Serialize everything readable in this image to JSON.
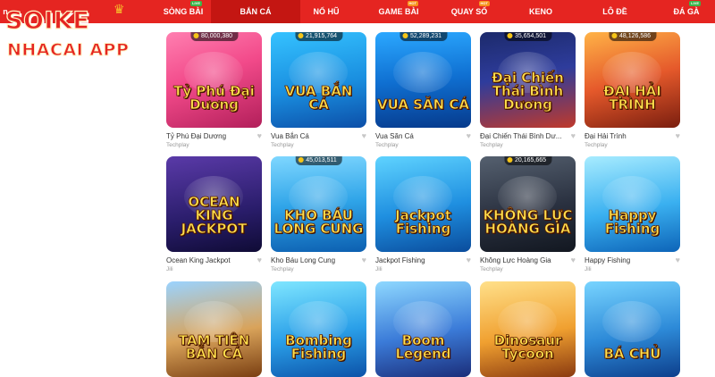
{
  "brand": {
    "line1": "SOIKE",
    "line2": "NHACAI APP"
  },
  "colors": {
    "nav": "#e52521",
    "nav_active": "#c41612",
    "live_tag": "#3ab54a",
    "hot_tag": "#f7931e"
  },
  "nav": {
    "partial_left": "n",
    "items": [
      {
        "label": "SÒNG BÀI",
        "tag": "LIVE"
      },
      {
        "label": "BẮN CÁ"
      },
      {
        "label": "NỔ HŨ"
      },
      {
        "label": "GAME BÀI",
        "tag": "HOT"
      },
      {
        "label": "QUAY SỐ",
        "tag": "HOT"
      },
      {
        "label": "KENO"
      },
      {
        "label": "LÔ ĐỀ"
      },
      {
        "label": "ĐÁ GÀ",
        "tag": "LIVE"
      }
    ]
  },
  "games": [
    {
      "title": "Tỷ Phú Đại Dương",
      "provider": "Techplay",
      "jackpot": "80,000,380",
      "art_text": "Tỷ Phú Đại Dương"
    },
    {
      "title": "Vua Bắn Cá",
      "provider": "Techplay",
      "jackpot": "21,915,764",
      "art_text": "VUA BẮN CÁ"
    },
    {
      "title": "Vua Săn Cá",
      "provider": "Techplay",
      "jackpot": "52,289,231",
      "art_text": "VUA SĂN CÁ"
    },
    {
      "title": "Đại Chiến Thái Bình Dư...",
      "provider": "Techplay",
      "jackpot": "35,654,501",
      "art_text": "Đại Chiến Thái Bình Dương"
    },
    {
      "title": "Đại Hải Trình",
      "provider": "Techplay",
      "jackpot": "48,126,586",
      "art_text": "ĐẠI HẢI TRÌNH"
    },
    {
      "title": "Ocean King Jackpot",
      "provider": "Jili",
      "jackpot": "",
      "art_text": "OCEAN KING JACKPOT"
    },
    {
      "title": "Kho Báu Long Cung",
      "provider": "Techplay",
      "jackpot": "45,013,511",
      "art_text": "KHO BÁU LONG CUNG"
    },
    {
      "title": "Jackpot Fishing",
      "provider": "Jili",
      "jackpot": "",
      "art_text": "Jackpot Fishing"
    },
    {
      "title": "Không Lực Hoàng Gia",
      "provider": "Techplay",
      "jackpot": "20,165,665",
      "art_text": "KHÔNG LỰC HOÀNG GIA"
    },
    {
      "title": "Happy Fishing",
      "provider": "Jili",
      "jackpot": "",
      "art_text": "Happy Fishing"
    },
    {
      "title": "",
      "provider": "",
      "jackpot": "",
      "art_text": "TAM TIÊN BẮN CÁ"
    },
    {
      "title": "",
      "provider": "",
      "jackpot": "",
      "art_text": "Bombing Fishing"
    },
    {
      "title": "",
      "provider": "",
      "jackpot": "",
      "art_text": "Boom Legend"
    },
    {
      "title": "",
      "provider": "",
      "jackpot": "",
      "art_text": "Dinosaur Tycoon"
    },
    {
      "title": "",
      "provider": "",
      "jackpot": "",
      "art_text": "BÁ CHỦ"
    }
  ]
}
